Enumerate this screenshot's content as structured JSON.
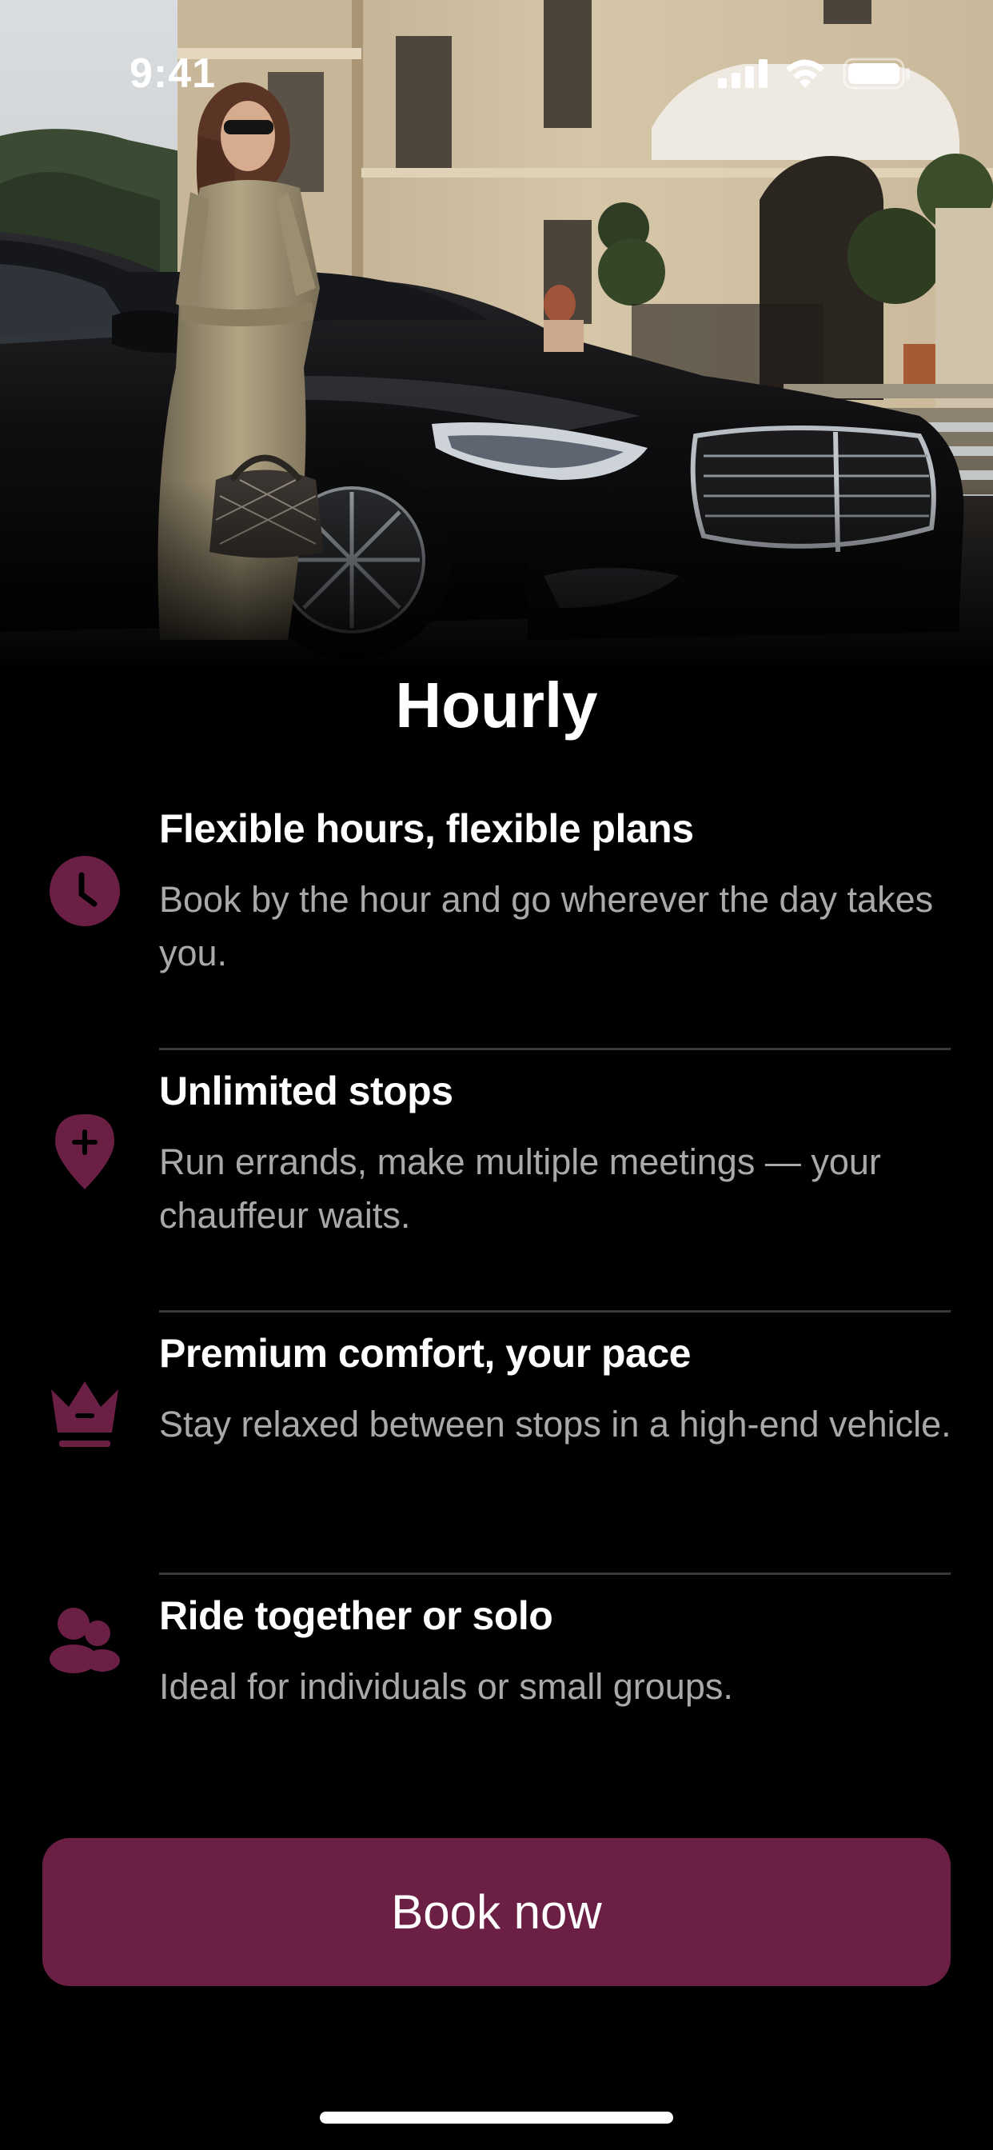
{
  "status_bar": {
    "time": "9:41"
  },
  "hero": {
    "image": "woman-standing-beside-black-luxury-sedan-in-front-of-villa"
  },
  "page": {
    "title": "Hourly"
  },
  "features": [
    {
      "icon": "clock-icon",
      "title": "Flexible hours, flexible plans",
      "description": "Book by the hour and go wherever the day takes you."
    },
    {
      "icon": "location-plus-icon",
      "title": "Unlimited stops",
      "description": "Run errands, make multiple meetings — your chauffeur waits."
    },
    {
      "icon": "crown-icon",
      "title": "Premium comfort, your pace",
      "description": "Stay relaxed between stops in a high-end vehicle."
    },
    {
      "icon": "users-icon",
      "title": "Ride together or solo",
      "description": "Ideal for individuals or small groups."
    }
  ],
  "cta": {
    "label": "Book now"
  },
  "colors": {
    "accent": "#6b1f45",
    "background": "#000000",
    "text_primary": "#ffffff",
    "text_secondary": "#a9a9a9",
    "divider": "#3a3a3a"
  }
}
